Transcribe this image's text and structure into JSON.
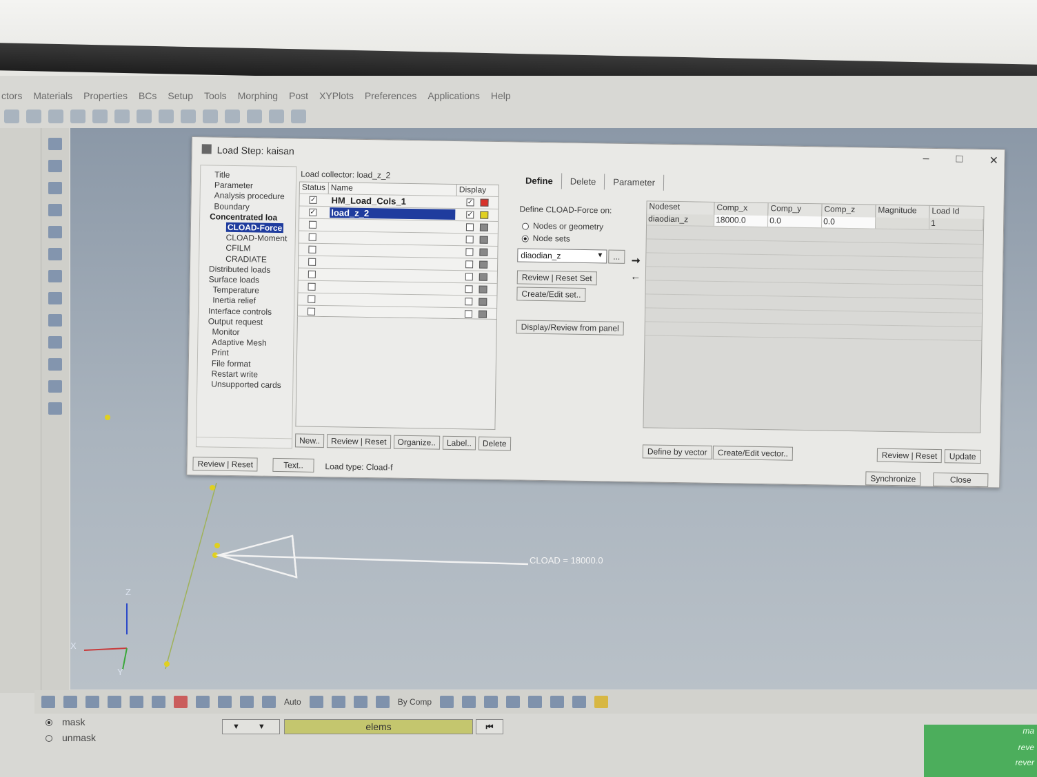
{
  "menubar": [
    "ctors",
    "Materials",
    "Properties",
    "BCs",
    "Setup",
    "Tools",
    "Morphing",
    "Post",
    "XYPlots",
    "Preferences",
    "Applications",
    "Help"
  ],
  "dialog": {
    "title": "Load Step: kaisan",
    "tree": [
      {
        "label": "Title",
        "style": ""
      },
      {
        "label": "Parameter",
        "style": ""
      },
      {
        "label": "Analysis procedure",
        "style": ""
      },
      {
        "label": "Boundary",
        "style": ""
      },
      {
        "label": "Concentrated loa",
        "style": "bold"
      },
      {
        "label": "CLOAD-Force",
        "style": "sel"
      },
      {
        "label": "CLOAD-Moment",
        "style": ""
      },
      {
        "label": "CFILM",
        "style": ""
      },
      {
        "label": "CRADIATE",
        "style": ""
      },
      {
        "label": "Distributed loads",
        "style": ""
      },
      {
        "label": "Surface loads",
        "style": ""
      },
      {
        "label": "Temperature",
        "style": ""
      },
      {
        "label": "Inertia relief",
        "style": ""
      },
      {
        "label": "Interface controls",
        "style": ""
      },
      {
        "label": "Output request",
        "style": ""
      },
      {
        "label": "Monitor",
        "style": ""
      },
      {
        "label": "Adaptive Mesh",
        "style": ""
      },
      {
        "label": "Print",
        "style": ""
      },
      {
        "label": "File format",
        "style": ""
      },
      {
        "label": "Restart write",
        "style": ""
      },
      {
        "label": "Unsupported cards",
        "style": ""
      }
    ],
    "collector": {
      "title": "Load collector: load_z_2",
      "headers": [
        "Status",
        "Name",
        "Display"
      ],
      "rows": [
        {
          "name": "HM_Load_Cols_1",
          "checked": true,
          "color": "#d8322a"
        },
        {
          "name": "load_z_2",
          "checked": true,
          "color": "#e0d020"
        }
      ],
      "buttons": [
        "New..",
        "Review | Reset",
        "Organize..",
        "Label..",
        "Delete"
      ]
    },
    "tabs": [
      "Define",
      "Delete",
      "Parameter"
    ],
    "define_label": "Define CLOAD-Force on:",
    "radio_nodes": "Nodes or geometry",
    "radio_sets": "Node sets",
    "nodeset_value": "diaodian_z",
    "buttons_right": {
      "review_reset_set": "Review | Reset Set",
      "create_edit_set": "Create/Edit set..",
      "display_review": "Display/Review from panel",
      "define_by_vector": "Define by vector",
      "create_edit_vector": "Create/Edit vector..",
      "review_reset": "Review | Reset",
      "update": "Update",
      "synchronize": "Synchronize",
      "close": "Close",
      "review_reset_left": "Review | Reset",
      "text": "Text..",
      "ellipsis": "..."
    },
    "load_type": "Load type:  Cload-f",
    "nodeset_table": {
      "headers": [
        "Nodeset",
        "Comp_x",
        "Comp_y",
        "Comp_z",
        "Magnitude",
        "Load Id"
      ],
      "row": [
        "diaodian_z",
        "18000.0",
        "0.0",
        "0.0",
        "",
        "1"
      ]
    }
  },
  "viewport": {
    "cload_label": "CLOAD = 18000.0",
    "axis_z": "Z",
    "axis_x": "X",
    "axis_y": "Y"
  },
  "bottombar": {
    "auto": "Auto",
    "bycomp": "By Comp",
    "mask": "mask",
    "unmask": "unmask",
    "elems": "elems",
    "green_lines": [
      "ma",
      "reve",
      "rever"
    ]
  }
}
